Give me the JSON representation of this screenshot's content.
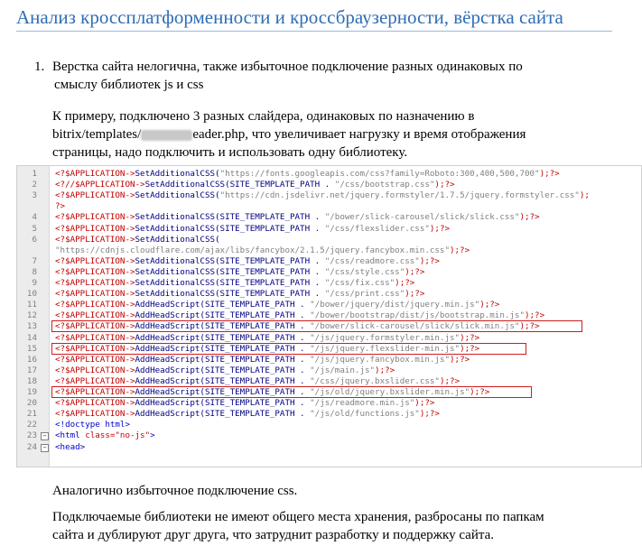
{
  "heading": "Анализ кроссплатформенности и кроссбраузерности, вёрстка сайта",
  "list_item": {
    "number": "1.",
    "text_line1": "Верстка сайта нелогична, также избыточное подключение разных одинаковых по",
    "text_line2": "смыслу библиотек js и css"
  },
  "para1": {
    "line1": "К примеру, подключено 3 разных слайдера, одинаковых по назначению в",
    "line2_a": "bitrix/templates/",
    "line2_b": "eader.php",
    "line2_c": ", что увеличивает нагрузку и время отображения",
    "line3": "страницы, надо подключить и использовать одну библиотеку."
  },
  "code": {
    "lines": [
      {
        "n": "1",
        "a": "<?$APPLICATION->",
        "b": "SetAdditionalCSS(",
        "c": "\"https://fonts.googleapis.com/css?family=Roboto:300,400,500,700\"",
        "d": ");?>"
      },
      {
        "n": "2",
        "a": "<?//$APPLICATION->",
        "b": "SetAdditionalCSS(SITE_TEMPLATE_PATH . ",
        "c": "\"/css/bootstrap.css\"",
        "d": ");?>"
      },
      {
        "n": "3",
        "a": "<?$APPLICATION->",
        "b": "SetAdditionalCSS(",
        "c": "\"https://cdn.jsdelivr.net/jquery.formstyler/1.7.5/jquery.formstyler.css\"",
        "d": ");"
      },
      {
        "n": "",
        "a": "?>",
        "b": "",
        "c": "",
        "d": ""
      },
      {
        "n": "4",
        "a": "<?$APPLICATION->",
        "b": "SetAdditionalCSS(SITE_TEMPLATE_PATH . ",
        "c": "\"/bower/slick-carousel/slick/slick.css\"",
        "d": ");?>"
      },
      {
        "n": "5",
        "a": "<?$APPLICATION->",
        "b": "SetAdditionalCSS(SITE_TEMPLATE_PATH . ",
        "c": "\"/css/flexslider.css\"",
        "d": ");?>"
      },
      {
        "n": "6",
        "a": "<?$APPLICATION->",
        "b": "SetAdditionalCSS(",
        "c": "",
        "d": ""
      },
      {
        "n": "",
        "a": "",
        "b": "",
        "c": "\"https://cdnjs.cloudflare.com/ajax/libs/fancybox/2.1.5/jquery.fancybox.min.css\"",
        "d": ");?>"
      },
      {
        "n": "7",
        "a": "<?$APPLICATION->",
        "b": "SetAdditionalCSS(SITE_TEMPLATE_PATH . ",
        "c": "\"/css/readmore.css\"",
        "d": ");?>"
      },
      {
        "n": "8",
        "a": "<?$APPLICATION->",
        "b": "SetAdditionalCSS(SITE_TEMPLATE_PATH . ",
        "c": "\"/css/style.css\"",
        "d": ");?>"
      },
      {
        "n": "9",
        "a": "<?$APPLICATION->",
        "b": "SetAdditionalCSS(SITE_TEMPLATE_PATH . ",
        "c": "\"/css/fix.css\"",
        "d": ");?>"
      },
      {
        "n": "10",
        "a": "<?$APPLICATION->",
        "b": "SetAdditionalCSS(SITE_TEMPLATE_PATH . ",
        "c": "\"/css/print.css\"",
        "d": ");?>"
      },
      {
        "n": "11",
        "a": "<?$APPLICATION->",
        "b": "AddHeadScript(SITE_TEMPLATE_PATH . ",
        "c": "\"/bower/jquery/dist/jquery.min.js\"",
        "d": ");?>"
      },
      {
        "n": "12",
        "a": "<?$APPLICATION->",
        "b": "AddHeadScript(SITE_TEMPLATE_PATH . ",
        "c": "\"/bower/bootstrap/dist/js/bootstrap.min.js\"",
        "d": ");?>"
      },
      {
        "n": "13",
        "a": "<?$APPLICATION->",
        "b": "AddHeadScript(SITE_TEMPLATE_PATH . ",
        "c": "\"/bower/slick-carousel/slick/slick.min.js\"",
        "d": ");?>"
      },
      {
        "n": "14",
        "a": "<?$APPLICATION->",
        "b": "AddHeadScript(SITE_TEMPLATE_PATH . ",
        "c": "\"/js/jquery.formstyler.min.js\"",
        "d": ");?>"
      },
      {
        "n": "15",
        "a": "<?$APPLICATION->",
        "b": "AddHeadScript(SITE_TEMPLATE_PATH . ",
        "c": "\"/js/jquery.flexslider-min.js\"",
        "d": ");?>"
      },
      {
        "n": "16",
        "a": "<?$APPLICATION->",
        "b": "AddHeadScript(SITE_TEMPLATE_PATH . ",
        "c": "\"/js/jquery.fancybox.min.js\"",
        "d": ");?>"
      },
      {
        "n": "17",
        "a": "<?$APPLICATION->",
        "b": "AddHeadScript(SITE_TEMPLATE_PATH . ",
        "c": "\"/js/main.js\"",
        "d": ");?>"
      },
      {
        "n": "18",
        "a": "<?$APPLICATION->",
        "b": "AddHeadScript(SITE_TEMPLATE_PATH . ",
        "c": "\"/css/jquery.bxslider.css\"",
        "d": ");?>"
      },
      {
        "n": "19",
        "a": "<?$APPLICATION->",
        "b": "AddHeadScript(SITE_TEMPLATE_PATH . ",
        "c": "\"/js/old/jquery.bxslider.min.js\"",
        "d": ");?>"
      },
      {
        "n": "20",
        "a": "<?$APPLICATION->",
        "b": "AddHeadScript(SITE_TEMPLATE_PATH . ",
        "c": "\"/js/readmore.min.js\"",
        "d": ");?>"
      },
      {
        "n": "21",
        "a": "<?$APPLICATION->",
        "b": "AddHeadScript(SITE_TEMPLATE_PATH . ",
        "c": "\"/js/old/functions.js\"",
        "d": ");?>"
      },
      {
        "n": "22",
        "a": "",
        "b": "<!doctype html>",
        "c": "",
        "d": ""
      },
      {
        "n": "23",
        "a": "",
        "b": "<html ",
        "c": "class=\"no-js\"",
        "d": ">"
      },
      {
        "n": "24",
        "a": "",
        "b": "<head>",
        "c": "",
        "d": ""
      }
    ],
    "highlighted_lines": [
      "13",
      "15",
      "19"
    ],
    "highlight_color": "#d01c1c"
  },
  "para2": "Аналогично избыточное подключение css.",
  "para3": {
    "line1": "Подключаемые библиотеки не имеют общего места хранения, разбросаны по папкам",
    "line2": "сайта и дублируют друг друга, что затруднит разработку и поддержку сайта."
  }
}
